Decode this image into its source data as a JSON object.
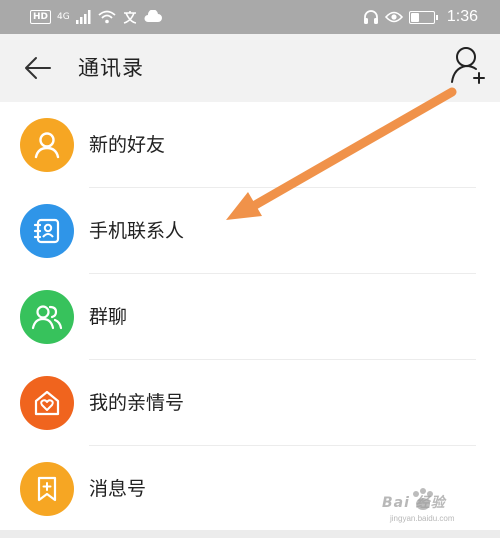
{
  "status_bar": {
    "hd_badge": "HD",
    "network": "4G",
    "battery_level": 0.35,
    "time": "1:36"
  },
  "header": {
    "title": "通讯录"
  },
  "items": [
    {
      "label": "新的好友",
      "icon": "person-icon",
      "color": "#f6a623"
    },
    {
      "label": "手机联系人",
      "icon": "contact-book-icon",
      "color": "#2f95e8"
    },
    {
      "label": "群聊",
      "icon": "group-icon",
      "color": "#37c25c"
    },
    {
      "label": "我的亲情号",
      "icon": "heart-home-icon",
      "color": "#f0641e"
    },
    {
      "label": "消息号",
      "icon": "bookmark-plus-icon",
      "color": "#f6a623"
    }
  ],
  "annotation": {
    "arrow_color": "#f0924a"
  },
  "watermark": {
    "text": "Bai 经验",
    "sub": "jingyan.baidu.com"
  }
}
